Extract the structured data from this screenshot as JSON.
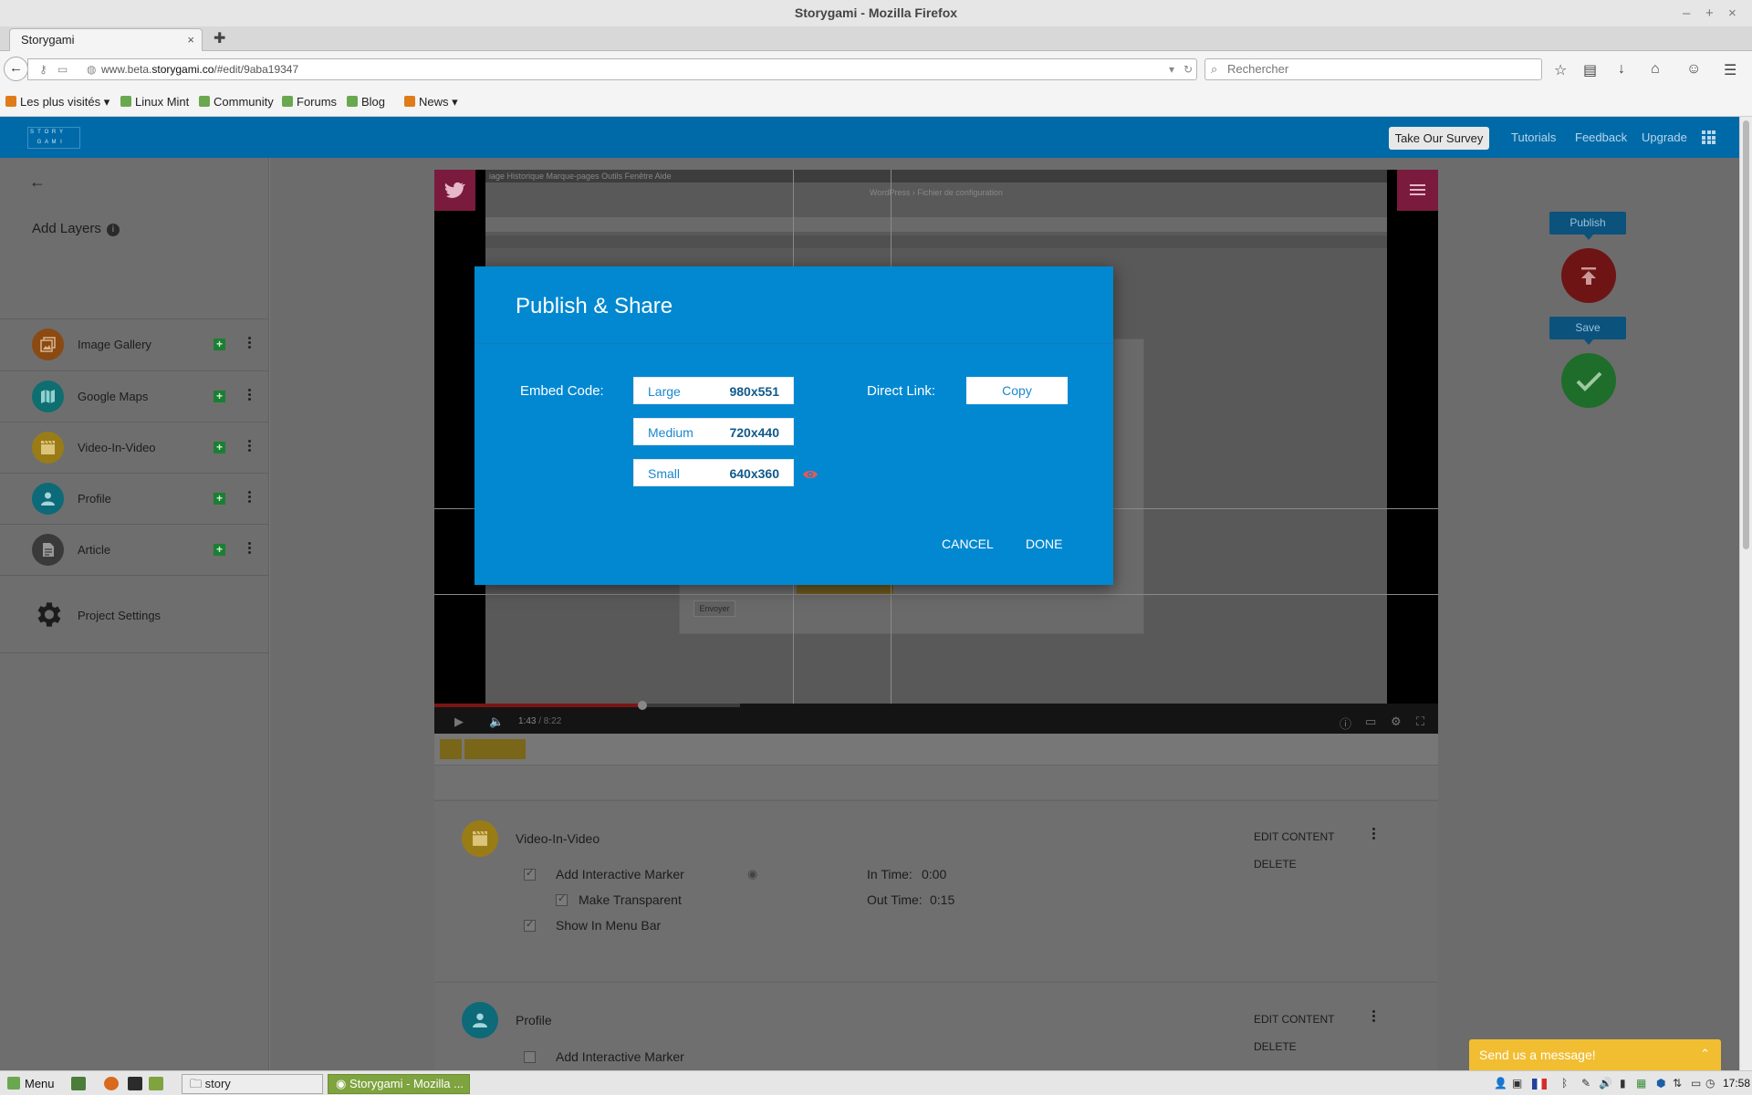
{
  "window": {
    "title": "Storygami - Mozilla Firefox",
    "minimize": "–",
    "maximize": "+",
    "close": "×"
  },
  "browser": {
    "tab_title": "Storygami",
    "tab_close": "×",
    "new_tab": "✚",
    "url_prefix": "www.beta.",
    "url_host": "storygami.co",
    "url_path": "/#edit/9aba19347",
    "search_placeholder": "Rechercher",
    "bookmarks": [
      "Les plus visités",
      "Linux Mint",
      "Community",
      "Forums",
      "Blog",
      "News"
    ]
  },
  "app": {
    "logo_letters": [
      "S",
      "T",
      "O",
      "R",
      "Y",
      "",
      "",
      " ",
      "G",
      "A",
      "M",
      "I",
      "",
      ""
    ],
    "take_survey": "Take Our Survey",
    "nav_links": [
      "Tutorials",
      "Feedback",
      "Upgrade"
    ]
  },
  "sidebar": {
    "title": "Add Layers",
    "info": "i",
    "items": [
      {
        "label": "Image Gallery",
        "color": "#8a4a12"
      },
      {
        "label": "Google Maps",
        "color": "#0e6e70"
      },
      {
        "label": "Video-In-Video",
        "color": "#9a7c17"
      },
      {
        "label": "Profile",
        "color": "#0d6a78"
      },
      {
        "label": "Article",
        "color": "#3a3a3a"
      }
    ],
    "settings_label": "Project Settings",
    "plus": "+"
  },
  "video": {
    "current_time": "1:43",
    "duration": " / 8:22",
    "progress_fraction": 0.207,
    "embedded_menu": "iage   Historique   Marque-pages   Outils   Fenêtre   Aide",
    "embedded_title": "WordPress › Fichier de configuration",
    "embedded_button": "Envoyer"
  },
  "fabs": {
    "publish_tip": "Publish",
    "save_tip": "Save"
  },
  "cards": [
    {
      "title": "Video-In-Video",
      "icon_color": "#9a7c17",
      "edit": "EDIT CONTENT",
      "delete": "DELETE",
      "checks": [
        {
          "label": "Add Interactive Marker",
          "checked": true
        },
        {
          "label": "Make Transparent",
          "checked": true
        },
        {
          "label": "Show In Menu Bar",
          "checked": true
        }
      ],
      "in_time_label": "In Time:",
      "in_time": "0:00",
      "out_time_label": "Out Time:",
      "out_time": "0:15"
    },
    {
      "title": "Profile",
      "icon_color": "#0d6a78",
      "edit": "EDIT CONTENT",
      "delete": "DELETE",
      "checks": [
        {
          "label": "Add Interactive Marker",
          "checked": false
        }
      ]
    }
  ],
  "modal": {
    "title": "Publish & Share",
    "embed_label": "Embed Code:",
    "sizes": [
      {
        "name": "Large",
        "dims": "980x551"
      },
      {
        "name": "Medium",
        "dims": "720x440"
      },
      {
        "name": "Small",
        "dims": "640x360"
      }
    ],
    "direct_link_label": "Direct Link:",
    "copy": "Copy",
    "cancel": "CANCEL",
    "done": "DONE",
    "accent": "#0288d1"
  },
  "chat": {
    "label": "Send us a message!",
    "caret": "⌃"
  },
  "taskbar": {
    "menu": "Menu",
    "windows": [
      "story",
      "Storygami - Mozilla ..."
    ],
    "clock": "17:58"
  }
}
